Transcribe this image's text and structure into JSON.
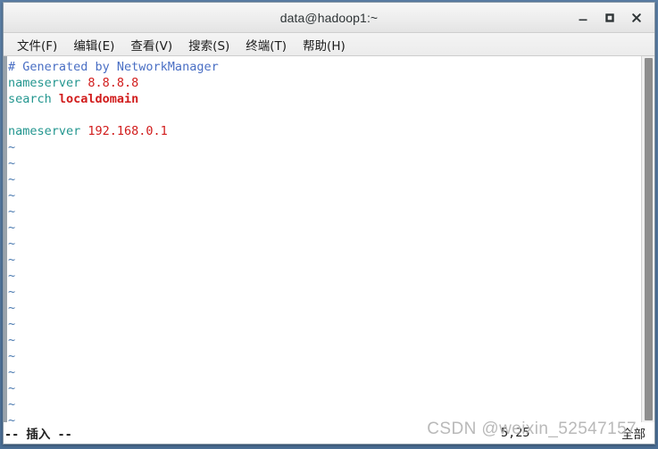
{
  "window": {
    "title": "data@hadoop1:~",
    "controls": [
      {
        "name": "minimize-button",
        "glyph": "_"
      },
      {
        "name": "maximize-button",
        "glyph": "□"
      },
      {
        "name": "close-button",
        "glyph": "✕"
      }
    ]
  },
  "menubar": {
    "items": [
      {
        "label": "文件(F)"
      },
      {
        "label": "编辑(E)"
      },
      {
        "label": "查看(V)"
      },
      {
        "label": "搜索(S)"
      },
      {
        "label": "终端(T)"
      },
      {
        "label": "帮助(H)"
      }
    ]
  },
  "editor": {
    "lines": [
      {
        "type": "comment",
        "text": "# Generated by NetworkManager"
      },
      {
        "type": "directive",
        "key": "nameserver",
        "value": "8.8.8.8"
      },
      {
        "type": "directive",
        "key": "search",
        "value": "localdomain"
      },
      {
        "type": "blank",
        "text": ""
      },
      {
        "type": "directive",
        "key": "nameserver",
        "value": "192.168.0.1"
      }
    ],
    "empty_marker": "~",
    "empty_line_count": 18
  },
  "statusline": {
    "mode": "-- 插入 --",
    "position": "5,25",
    "scope": "全部"
  },
  "watermark": {
    "text": "CSDN @weixin_52547157"
  },
  "colors": {
    "comment": "#4a6fc4",
    "keyword": "#23968f",
    "value": "#d11c1c",
    "tilde": "#4a7ab0",
    "background": "#ffffff",
    "titlebar": "#ededed",
    "desktop": "#4a6e95"
  }
}
